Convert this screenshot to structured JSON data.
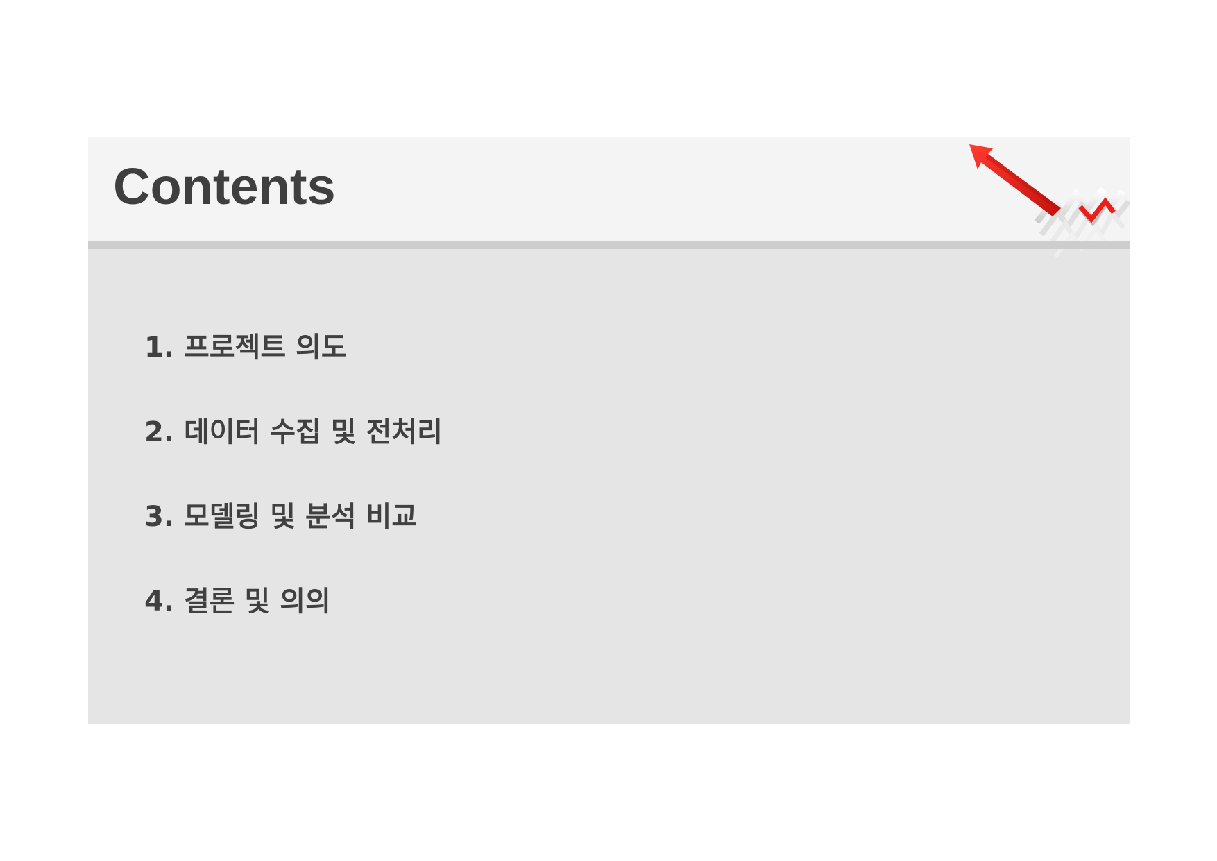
{
  "slide": {
    "title": "Contents",
    "decoration_icon": "rising-arrow-icon",
    "colors": {
      "header_bg": "#f4f4f4",
      "body_bg": "#e5e5e5",
      "rule": "#cdcdcd",
      "text": "#404040",
      "accent": "#e8201c"
    }
  },
  "toc": {
    "items": [
      {
        "label": "1. 프로젝트 의도"
      },
      {
        "label": "2. 데이터 수집 및 전처리"
      },
      {
        "label": "3. 모델링 및 분석 비교"
      },
      {
        "label": "4. 결론 및 의의"
      }
    ]
  }
}
